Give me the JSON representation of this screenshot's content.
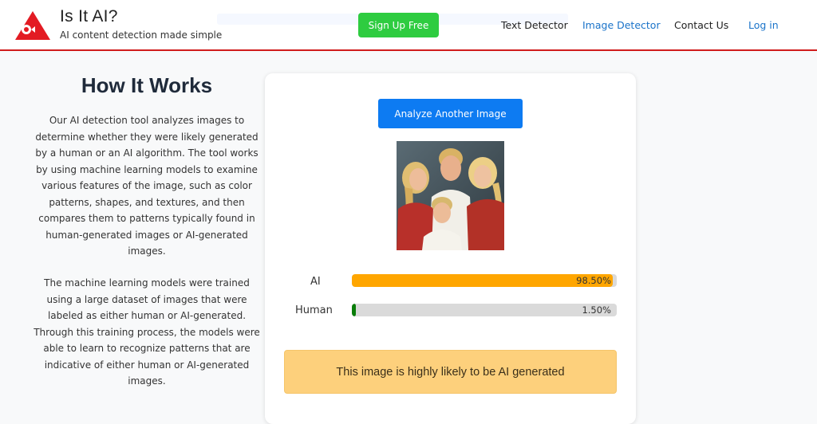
{
  "brand": {
    "title": "Is It AI?",
    "subtitle": "AI content detection made simple",
    "logo": "red-triangle-logo"
  },
  "header": {
    "signup_label": "Sign Up Free",
    "nav": [
      "Text Detector",
      "Image Detector",
      "Contact Us",
      "Log in"
    ],
    "active_nav": "Image Detector",
    "accent_color": "#d01c1c"
  },
  "how": {
    "title": "How It Works",
    "p1": "Our AI detection tool analyzes images to determine whether they were likely generated by a human or an AI algorithm. The tool works by using machine learning models to examine various features of the image, such as color patterns, shapes, and textures, and then compares them to patterns typically found in human-generated images or AI-generated images.",
    "p2": "The machine learning models were trained using a large dataset of images that were labeled as either human or AI-generated. Through this training process, the models were able to learn to recognize patterns that are indicative of either human or AI-generated images."
  },
  "result": {
    "analyze_label": "Analyze Another Image",
    "image_icon": "family-portrait-image",
    "ai": {
      "label": "AI",
      "value_text": "98.50%",
      "fraction": 0.985,
      "color": "#ffa600"
    },
    "human": {
      "label": "Human",
      "value_text": "1.50%",
      "fraction": 0.015,
      "color": "#0a7d0a"
    },
    "verdict": "This image is highly likely to be AI generated"
  }
}
